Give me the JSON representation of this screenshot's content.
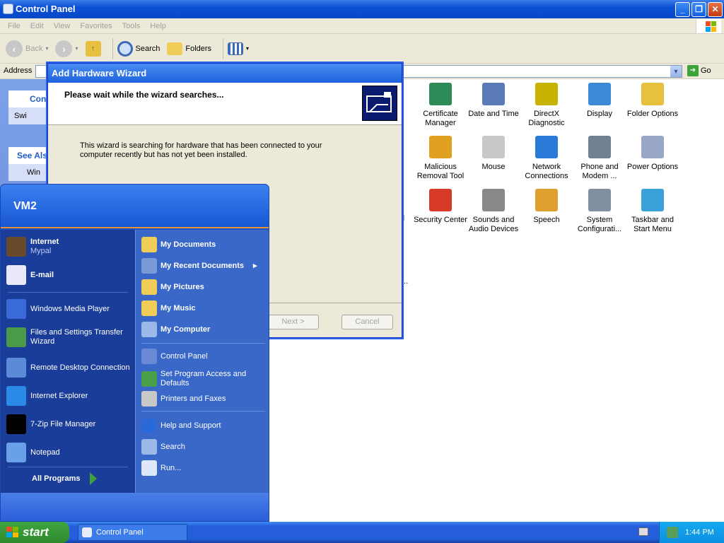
{
  "window": {
    "title": "Control Panel",
    "menu": [
      "File",
      "Edit",
      "View",
      "Favorites",
      "Tools",
      "Help"
    ],
    "toolbar": {
      "back": "Back",
      "search": "Search",
      "folders": "Folders"
    },
    "address_label": "Address",
    "go_label": "Go"
  },
  "taskpane": {
    "box1_head": "Con",
    "box1_item": "Swi",
    "box2_head": "See Als",
    "box2_item": "Win"
  },
  "control_panel_items": [
    {
      "label": "Certificate Manager",
      "icon": "certificate-icon",
      "color": "#2e8b57"
    },
    {
      "label": "Date and Time",
      "icon": "clock-icon",
      "color": "#5a7ab8"
    },
    {
      "label": "DirectX Diagnostic",
      "icon": "directx-icon",
      "color": "#c8b400"
    },
    {
      "label": "Display",
      "icon": "display-icon",
      "color": "#3a8ad8"
    },
    {
      "label": "Folder Options",
      "icon": "folder-icon",
      "color": "#e8c040"
    },
    {
      "label": "Malicious Removal Tool",
      "icon": "malicious-tool-icon",
      "color": "#e0a020"
    },
    {
      "label": "Mouse",
      "icon": "mouse-icon",
      "color": "#c8c8c8"
    },
    {
      "label": "Network Connections",
      "icon": "network-icon",
      "color": "#2a7ad8"
    },
    {
      "label": "Phone and Modem ...",
      "icon": "phone-icon",
      "color": "#708090"
    },
    {
      "label": "Power Options",
      "icon": "power-icon",
      "color": "#9aa8c8"
    },
    {
      "label": "Security Center",
      "icon": "shield-icon",
      "color": "#d83a2a"
    },
    {
      "label": "Sounds and Audio Devices",
      "icon": "speaker-icon",
      "color": "#888888"
    },
    {
      "label": "Speech",
      "icon": "speech-icon",
      "color": "#e0a030"
    },
    {
      "label": "System Configurati...",
      "icon": "system-config-icon",
      "color": "#8090a0"
    },
    {
      "label": "Taskbar and Start Menu",
      "icon": "taskbar-icon",
      "color": "#3aa0d8"
    }
  ],
  "wizard": {
    "title": "Add Hardware Wizard",
    "heading": "Please wait while the wizard searches...",
    "body": "This wizard is searching for hardware that has been connected to your computer recently but has not yet been installed.",
    "next": "Next >",
    "cancel": "Cancel"
  },
  "start_menu": {
    "user": "VM2",
    "pinned": [
      {
        "label": "Internet",
        "sub": "Mypal",
        "icon": "raccoon-icon",
        "color": "#6a4a2a"
      },
      {
        "label": "E-mail",
        "sub": "",
        "icon": "email-icon",
        "color": "#e8e8f8"
      }
    ],
    "recent": [
      {
        "label": "Windows Media Player",
        "icon": "media-player-icon",
        "color": "#3a6ad8"
      },
      {
        "label": "Files and Settings Transfer Wizard",
        "icon": "transfer-wizard-icon",
        "color": "#4a9a4a"
      },
      {
        "label": "Remote Desktop Connection",
        "icon": "remote-desktop-icon",
        "color": "#5a8ad8"
      },
      {
        "label": "Internet Explorer",
        "icon": "ie-icon",
        "color": "#2a8ae8"
      },
      {
        "label": "7-Zip File Manager",
        "icon": "7zip-icon",
        "color": "#000000"
      },
      {
        "label": "Notepad",
        "icon": "notepad-icon",
        "color": "#6aa0e8"
      }
    ],
    "all_programs": "All Programs",
    "right_bold": [
      {
        "label": "My Documents",
        "icon": "documents-folder-icon"
      },
      {
        "label": "My Recent Documents",
        "icon": "recent-docs-icon"
      },
      {
        "label": "My Pictures",
        "icon": "pictures-folder-icon"
      },
      {
        "label": "My Music",
        "icon": "music-folder-icon"
      },
      {
        "label": "My Computer",
        "icon": "computer-icon"
      }
    ],
    "right_normal": [
      {
        "label": "Control Panel",
        "icon": "control-panel-icon"
      },
      {
        "label": "Set Program Access and Defaults",
        "icon": "program-access-icon"
      },
      {
        "label": "Printers and Faxes",
        "icon": "printer-icon"
      },
      {
        "label": "Help and Support",
        "icon": "help-icon"
      },
      {
        "label": "Search",
        "icon": "search-icon"
      },
      {
        "label": "Run...",
        "icon": "run-icon"
      }
    ]
  },
  "taskbar": {
    "start": "start",
    "task_button": "Control Panel",
    "clock": "1:44 PM"
  }
}
